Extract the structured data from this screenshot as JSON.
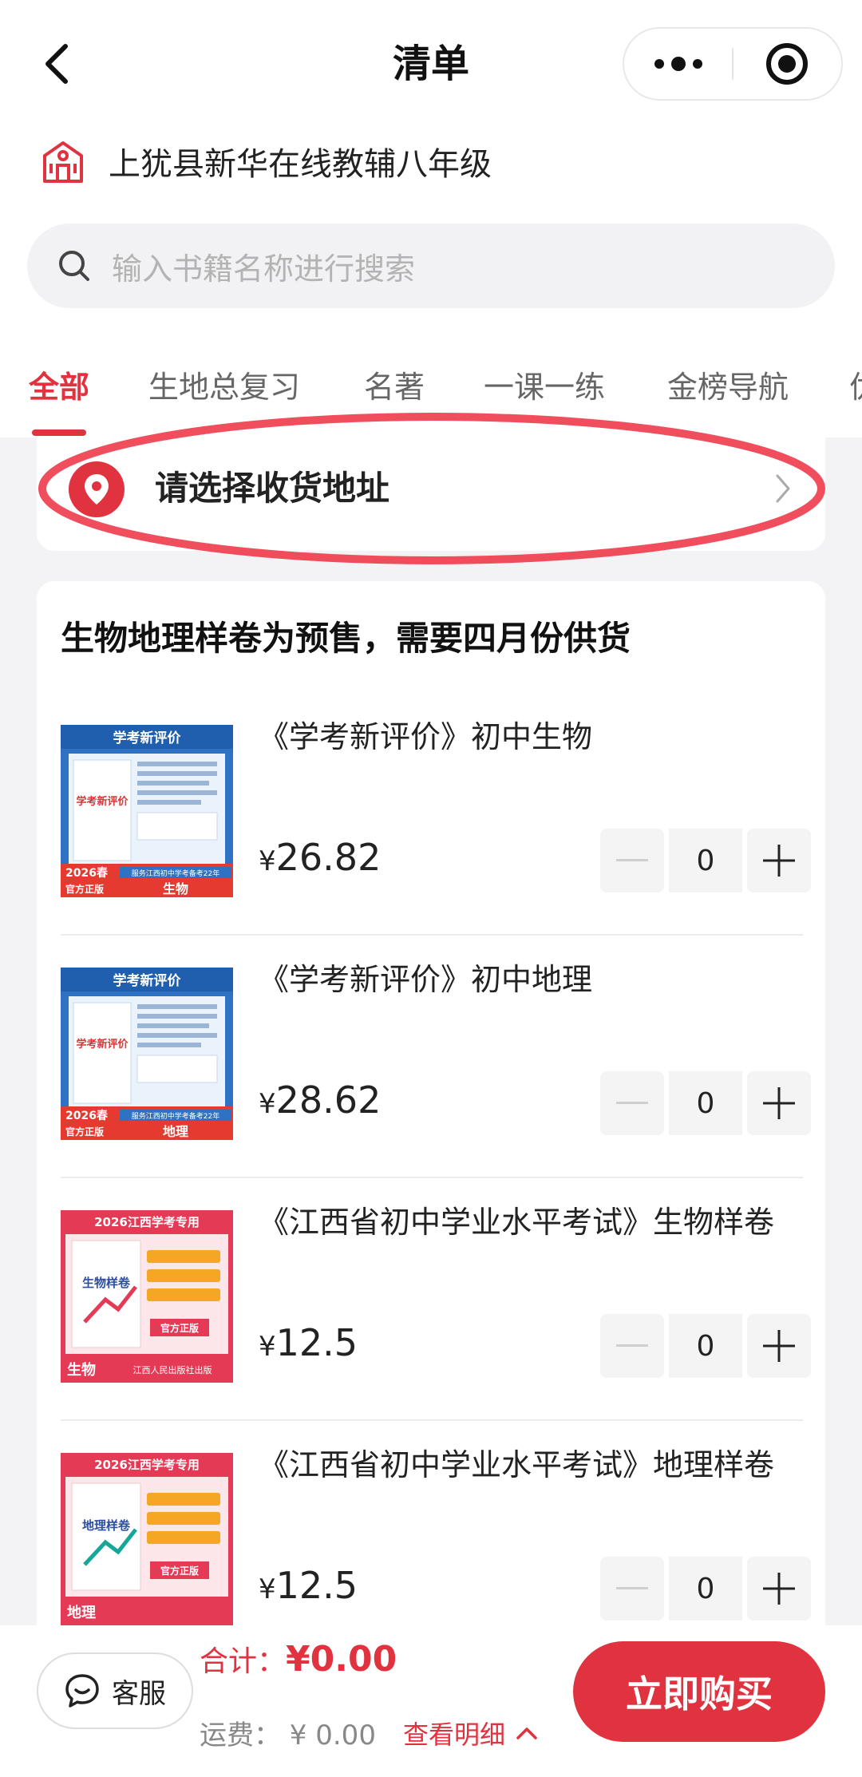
{
  "header": {
    "title": "清单"
  },
  "store": {
    "name": "上犹县新华在线教辅八年级"
  },
  "search": {
    "placeholder": "输入书籍名称进行搜索"
  },
  "tabs": [
    {
      "label": "全部",
      "active": true
    },
    {
      "label": "生地总复习"
    },
    {
      "label": "名著"
    },
    {
      "label": "一课一练"
    },
    {
      "label": "金榜导航"
    },
    {
      "label": "优"
    }
  ],
  "address": {
    "prompt": "请选择收货地址"
  },
  "notice": "生物地理样卷为预售，需要四月份供货",
  "products": [
    {
      "title": "《学考新评价》初中生物",
      "price": "26.82",
      "qty": "0",
      "cover": {
        "header": "学考新评价",
        "brand": "学考新评价",
        "year": "2026春",
        "official": "官方正版",
        "service": "服务江西初中学考备考22年",
        "subject": "生物"
      }
    },
    {
      "title": "《学考新评价》初中地理",
      "price": "28.62",
      "qty": "0",
      "cover": {
        "header": "学考新评价",
        "brand": "学考新评价",
        "year": "2026春",
        "official": "官方正版",
        "service": "服务江西初中学考备考22年",
        "subject": "地理"
      }
    },
    {
      "title": "《江西省初中学业水平考试》生物样卷",
      "price": "12.5",
      "qty": "0",
      "cover": {
        "header": "2026江西学考专用",
        "brand": "生物样卷",
        "official": "官方正版",
        "publisher": "江西人民出版社出版",
        "subject": "生物"
      }
    },
    {
      "title": "《江西省初中学业水平考试》地理样卷",
      "price": "12.5",
      "qty": "0",
      "cover": {
        "header": "2026江西学考专用",
        "brand": "地理样卷",
        "official": "官方正版",
        "subject": "地理"
      }
    }
  ],
  "currency": "¥",
  "footer": {
    "service_label": "客服",
    "total_label": "合计：",
    "total_value": "¥0.00",
    "shipping": "运费： ¥ 0.00",
    "detail_link": "查看明细",
    "buy_label": "立即购买"
  },
  "colors": {
    "accent": "#e0323f",
    "background": "#f3f3f5"
  },
  "icons": [
    "back-arrow-icon",
    "more-dots-icon",
    "target-icon",
    "store-icon",
    "search-icon",
    "location-pin-icon",
    "chevron-right-icon",
    "minus-icon",
    "plus-icon",
    "chat-icon",
    "chevron-up-icon"
  ]
}
